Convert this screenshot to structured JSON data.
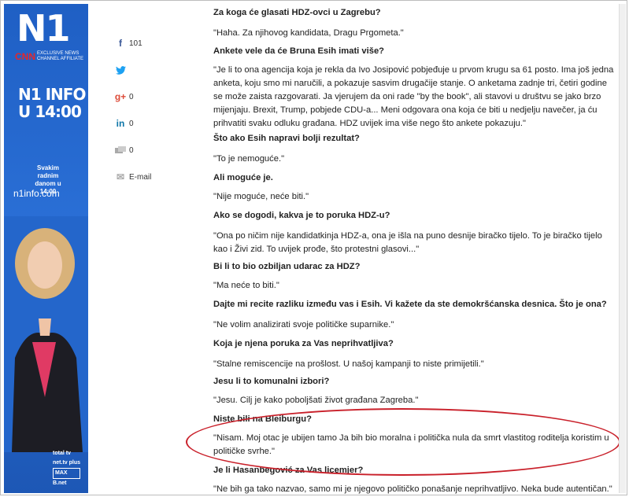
{
  "ad": {
    "logo": "N1",
    "cnn": "CNN",
    "affiliate": "EXCLUSIVE NEWS CHANNEL AFFILIATE",
    "headline_line1": "N1 INFO",
    "headline_line2": "U 14:00",
    "schedule_line1": "Svakim radnim",
    "schedule_line2": "danom u 14:00",
    "site": "n1info.com",
    "brand1": "total tv",
    "brand2": "net.tv plus",
    "brand3": "MAX",
    "brand4": "B.net"
  },
  "social": [
    {
      "icon": "facebook-icon",
      "glyph": "f",
      "count": "101"
    },
    {
      "icon": "twitter-icon",
      "glyph": "🐦",
      "count": ""
    },
    {
      "icon": "google-plus-icon",
      "glyph": "g+",
      "count": "0"
    },
    {
      "icon": "linkedin-icon",
      "glyph": "in",
      "count": "0"
    },
    {
      "icon": "comment-icon",
      "glyph": "▬",
      "count": "0"
    },
    {
      "icon": "email-icon",
      "glyph": "✉",
      "count": "E-mail"
    }
  ],
  "article": [
    {
      "type": "q",
      "text": "Za koga će glasati HDZ-ovci u Zagrebu?"
    },
    {
      "type": "a",
      "text": "\"Haha. Za njihovog kandidata, Dragu Prgometa.\""
    },
    {
      "type": "q",
      "text": "Ankete vele da će Bruna Esih imati više?"
    },
    {
      "type": "a",
      "text": "\"Je li to ona agencija koja je rekla da Ivo Josipović pobjeđuje u prvom krugu sa 61 posto. Ima još jedna anketa, koju smo mi naručili, a pokazuje sasvim drugačije stanje. O anketama zadnje tri, četiri godine se može zaista razgovarati. Ja vjerujem da oni rade \"by the book\", ali stavovi u društvu se jako brzo mijenjaju. Brexit, Trump, pobjede CDU-a... Meni odgovara ona koja će biti u nedjelju navečer, ja ću prihvatiti svaku odluku građana. HDZ uvijek ima više nego što ankete pokazuju.\""
    },
    {
      "type": "q",
      "text": "Što ako Esih napravi bolji rezultat?"
    },
    {
      "type": "a",
      "text": "\"To je nemoguće.\""
    },
    {
      "type": "q",
      "text": "Ali moguće je."
    },
    {
      "type": "a",
      "text": "\"Nije moguće, neće biti.\""
    },
    {
      "type": "q",
      "text": "Ako se dogodi, kakva je to poruka HDZ-u?"
    },
    {
      "type": "a",
      "text": "\"Ona po ničim nije kandidatkinja HDZ-a, ona je išla na puno desnije biračko tijelo. To je biračko tijelo kao i Živi zid. To uvijek prođe, što protestni glasovi...\""
    },
    {
      "type": "q",
      "text": "Bi li to bio ozbiljan udarac za HDZ?"
    },
    {
      "type": "a",
      "text": "\"Ma neće to biti.\""
    },
    {
      "type": "q",
      "text": "Dajte mi recite razliku između vas i Esih. Vi kažete da ste demokršćanska desnica. Što je ona?"
    },
    {
      "type": "a",
      "text": "\"Ne volim analizirati svoje političke suparnike.\""
    },
    {
      "type": "q",
      "text": "Koja je njena poruka za Vas neprihvatljiva?"
    },
    {
      "type": "a",
      "text": "\"Stalne remiscencije na prošlost. U našoj kampanji to niste primijetili.\""
    },
    {
      "type": "q",
      "text": "Jesu li to komunalni izbori?"
    },
    {
      "type": "a",
      "text": "\"Jesu. Cilj je kako poboljšati život građana Zagreba.\""
    },
    {
      "type": "q",
      "text": "Niste bili na Bleiburgu?"
    },
    {
      "type": "a",
      "text": "\"Nisam. Moj otac je ubijen tamo Ja bih bio moralna i politička nula da smrt vlastitog roditelja koristim u političke svrhe.\""
    },
    {
      "type": "q",
      "text": "Je li Hasanbegović za Vas licemjer?"
    },
    {
      "type": "a",
      "text": "\"Ne bih ga tako nazvao, samo mi je njegovo političko ponašanje neprihvatljivo. Neka bude autentičan.\""
    }
  ],
  "colors": {
    "ad_blue": "#2a6fd6",
    "highlight": "#c9202a"
  }
}
